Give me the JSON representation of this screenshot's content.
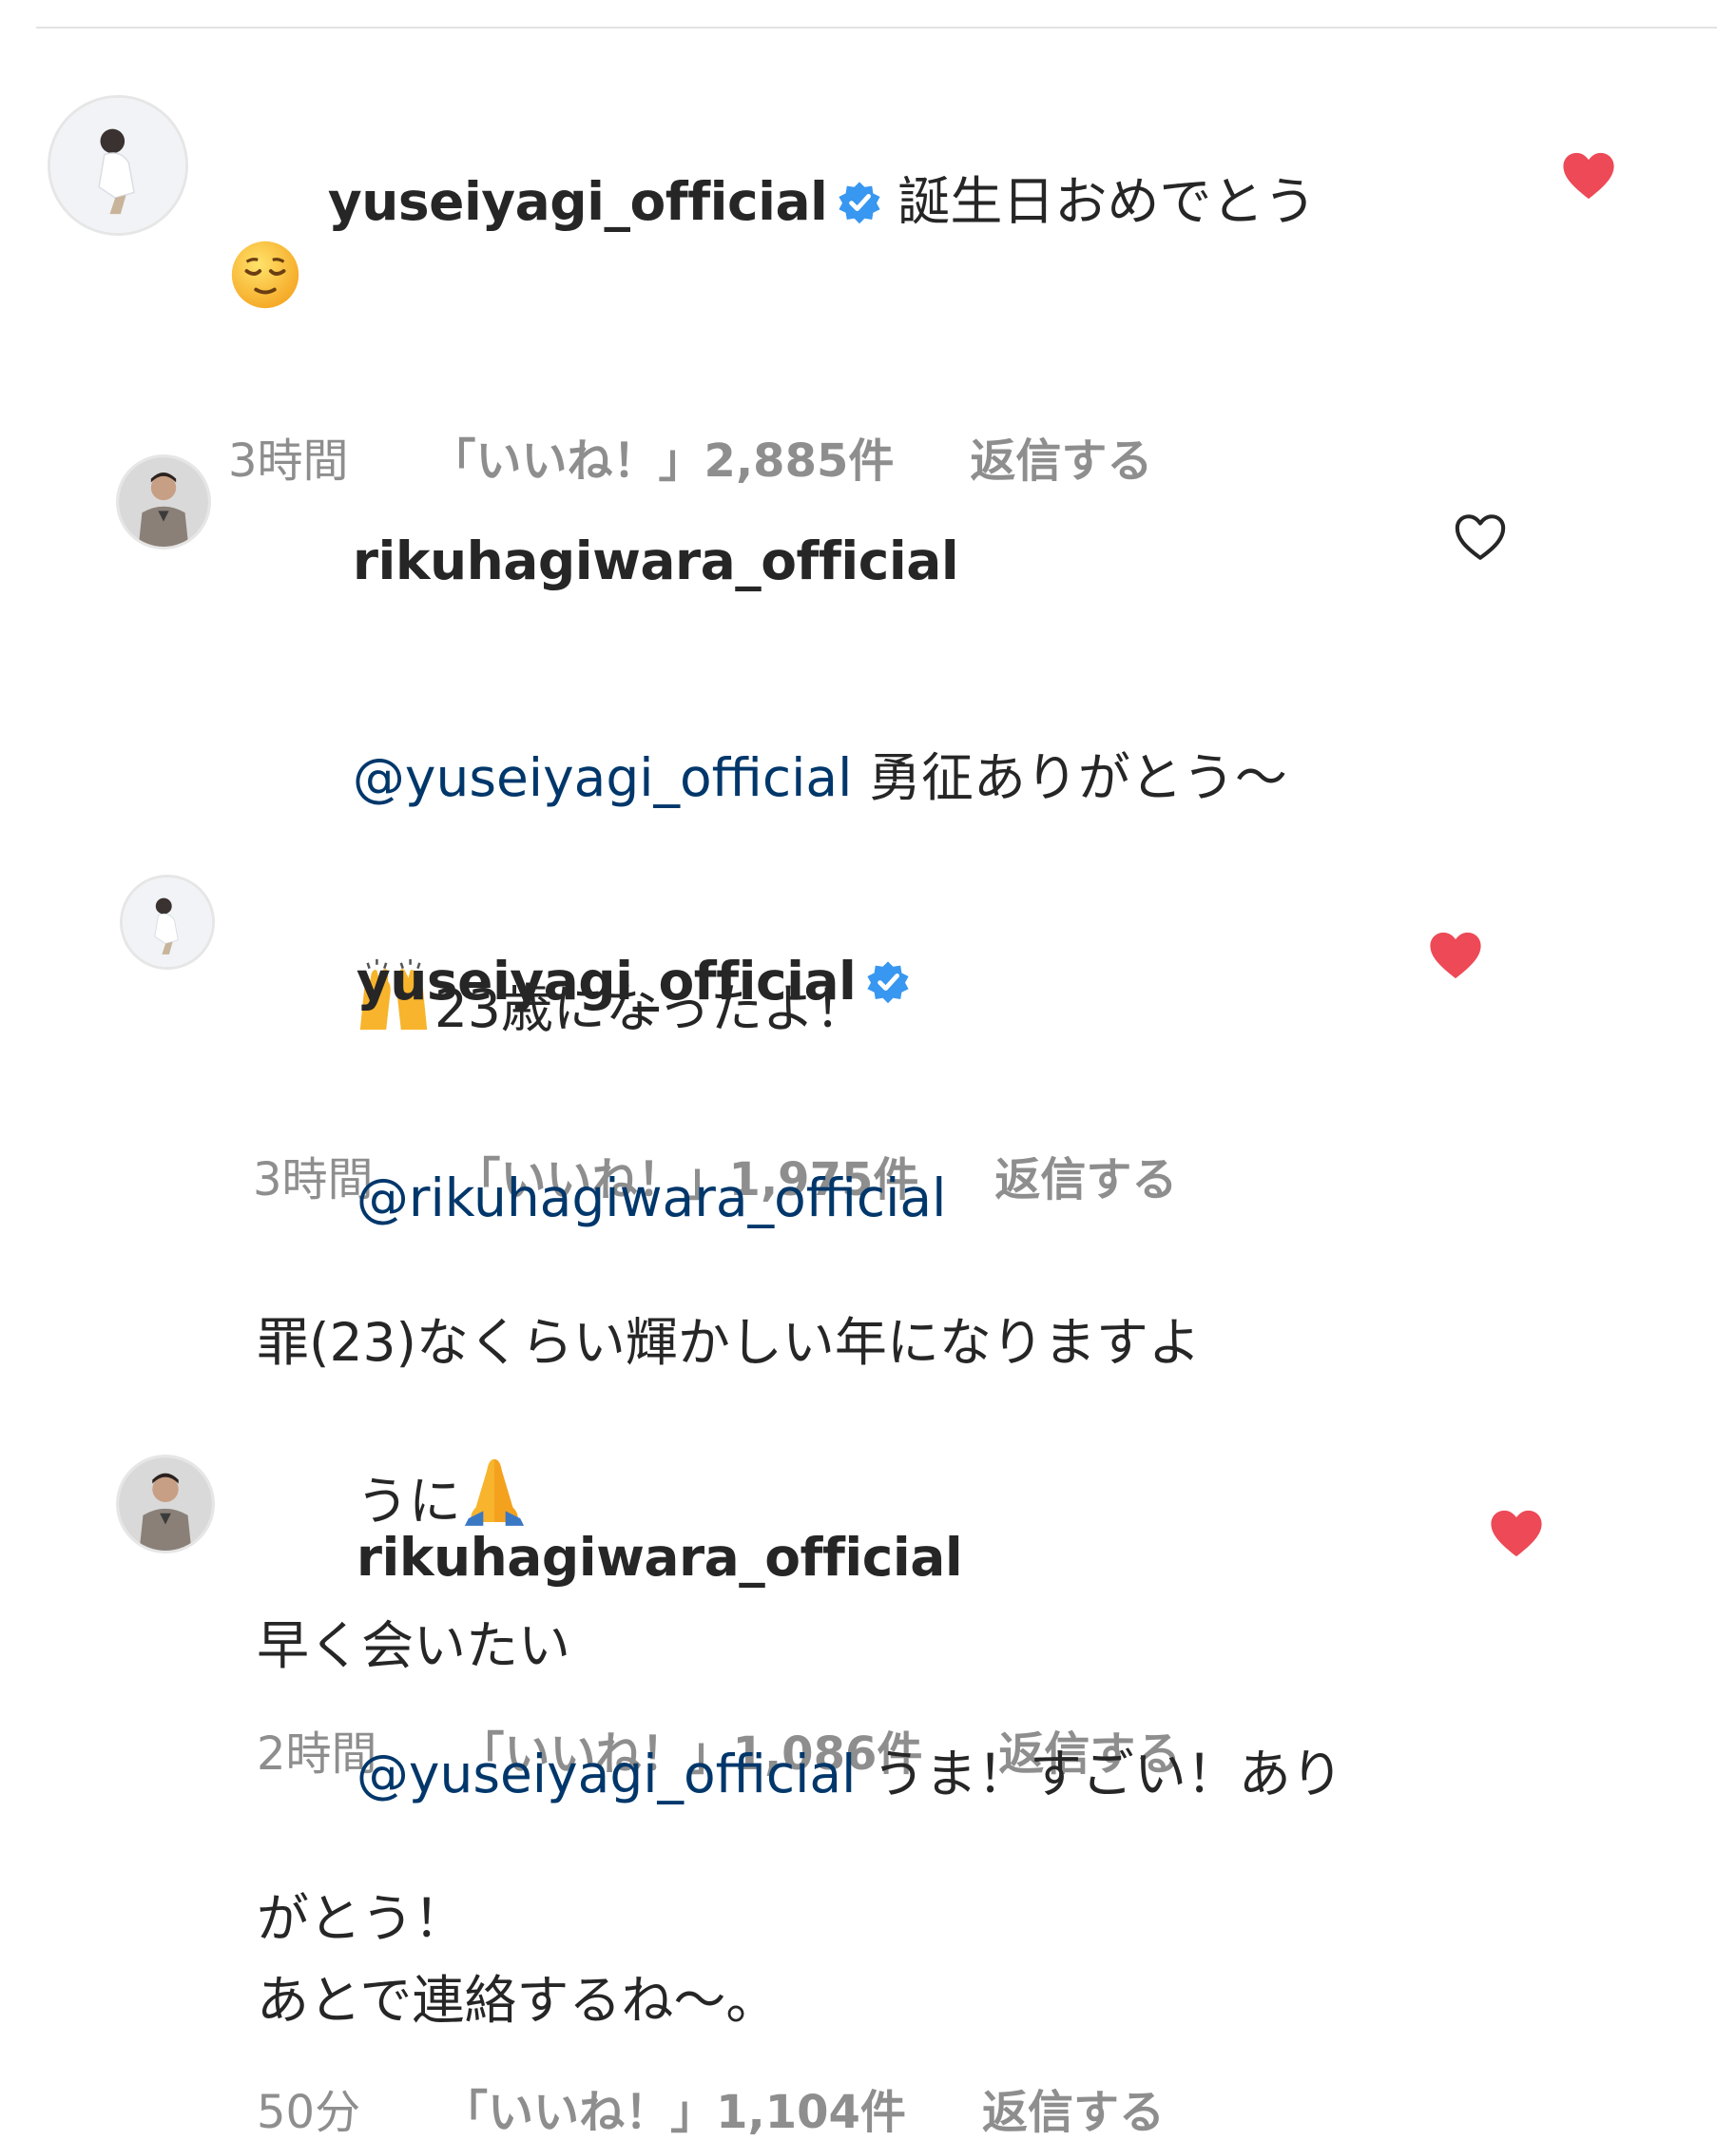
{
  "colors": {
    "heart_liked": "#ed4956",
    "heart_outline": "#262626",
    "verified": "#3897f0",
    "mention": "#00376b",
    "meta": "#8e8e8e"
  },
  "comments": [
    {
      "username": "yuseiyagi_official",
      "verified": true,
      "mention": "",
      "lines": [
        "誕生日おめでとう"
      ],
      "emoji": "relieved-face-emoji",
      "time": "3時間",
      "likes": "「いいね！」2,885件",
      "reply": "返信する",
      "liked": true
    },
    {
      "username": "rikuhagiwara_official",
      "verified": false,
      "mention": "@yuseiyagi_official",
      "line1_after_mention": " 勇征ありがとう〜",
      "line2": "23歳になったよ！",
      "emoji": "raising-hands-emoji",
      "time": "3時間",
      "likes": "「いいね！」1,975件",
      "reply": "返信する",
      "liked": false
    },
    {
      "username": "yuseiyagi_official",
      "verified": true,
      "mention": "@rikuhagiwara_official",
      "line1": "罪(23)なくらい輝かしい年になりますよ",
      "line2": "うに",
      "line3": "早く会いたい",
      "emoji": "folded-hands-emoji",
      "time": "2時間",
      "likes": "「いいね！」1,086件",
      "reply": "返信する",
      "liked": true
    },
    {
      "username": "rikuhagiwara_official",
      "verified": false,
      "mention": "@yuseiyagi_official",
      "line1_after_mention": " うま！すごい！あり",
      "line2": "がとう！",
      "line3": "あとで連絡するね〜。",
      "time": "50分",
      "likes": "「いいね！」1,104件",
      "reply": "返信する",
      "liked": true
    }
  ]
}
